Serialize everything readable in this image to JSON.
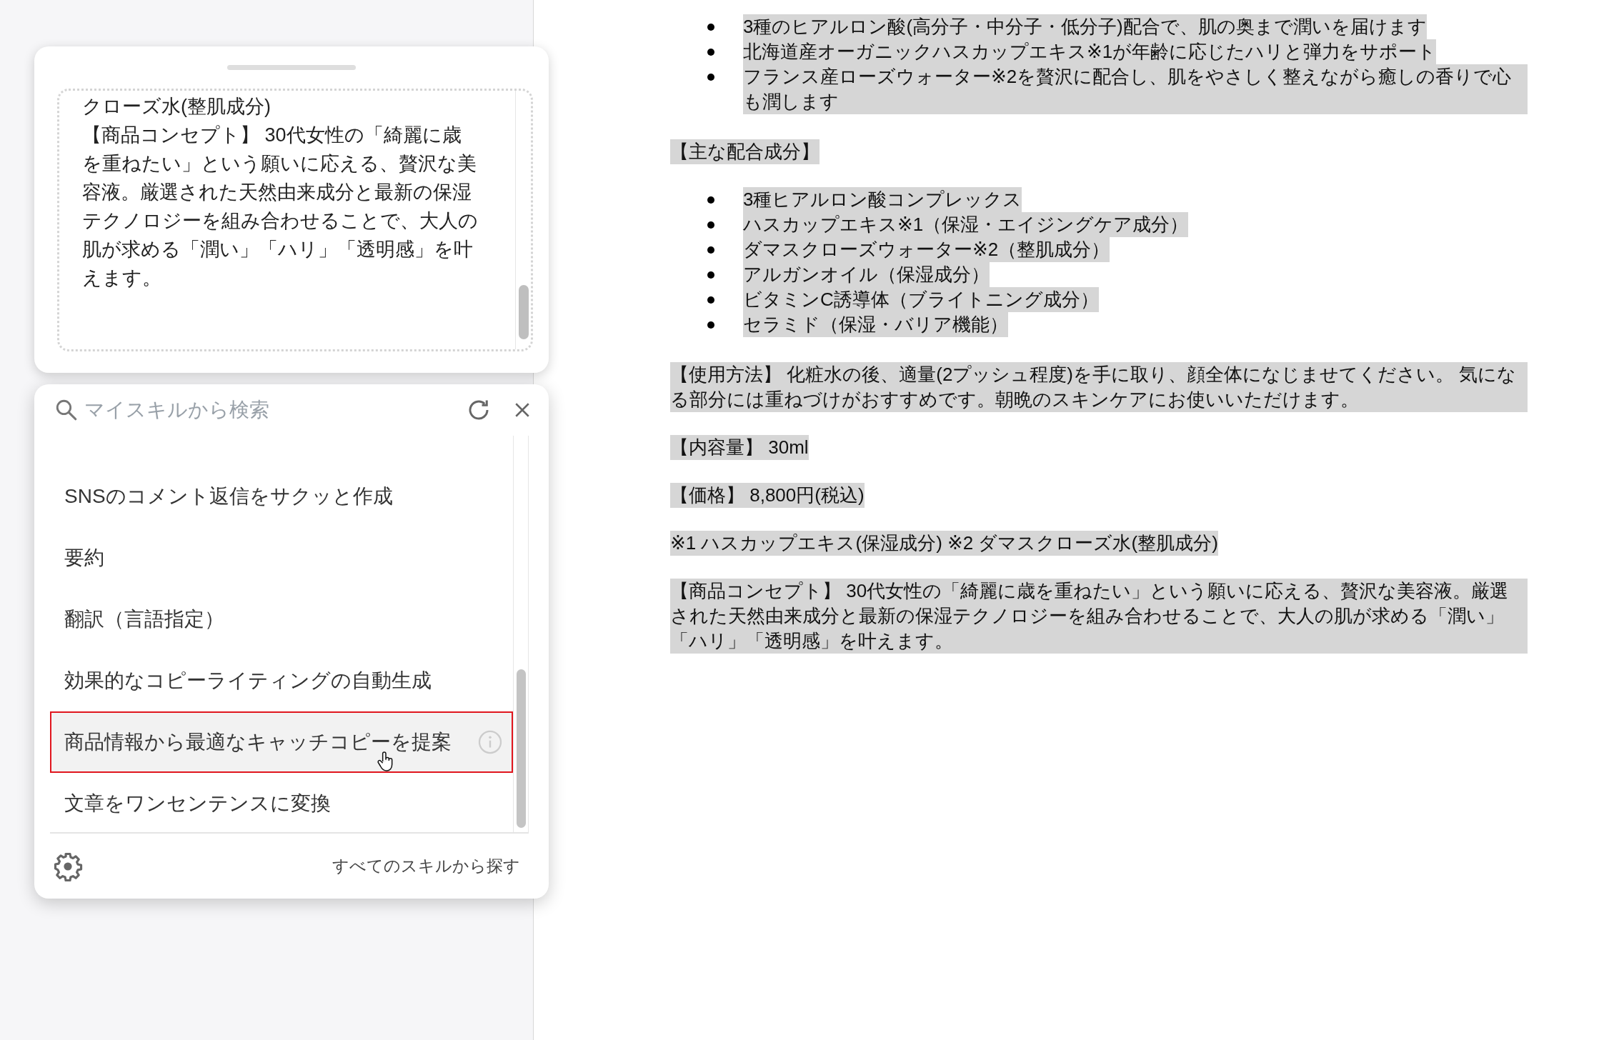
{
  "editor_card": {
    "paragraphs": [
      "クローズ水(整肌成分)",
      "【商品コンセプト】 30代女性の「綺麗に歳を重ねたい」という願いに応える、贅沢な美容液。厳選された天然由来成分と最新の保湿テクノロジーを組み合わせることで、大人の肌が求める「潤い」「ハリ」「透明感」を叶えます。"
    ]
  },
  "skill_menu": {
    "search": {
      "placeholder": "マイスキルから検索"
    },
    "items": [
      {
        "label": "SNSのコメント返信をサクッと作成",
        "selected": false
      },
      {
        "label": "要約",
        "selected": false
      },
      {
        "label": "翻訳（言語指定）",
        "selected": false
      },
      {
        "label": "効果的なコピーライティングの自動生成",
        "selected": false
      },
      {
        "label": "商品情報から最適なキャッチコピーを提案",
        "selected": true
      },
      {
        "label": "文章をワンセンテンスに変換",
        "selected": false
      }
    ],
    "footer_link": "すべてのスキルから探す"
  },
  "document": {
    "blocks": [
      {
        "kind": "bullets",
        "items": [
          "3種のヒアルロン酸(高分子・中分子・低分子)配合で、肌の奥まで潤いを届けます",
          "北海道産オーガニックハスカップエキス※1が年齢に応じたハリと弾力をサポート",
          "フランス産ローズウォーター※2を贅沢に配合し、肌をやさしく整えながら癒しの香りで心も潤します"
        ]
      },
      {
        "kind": "paragraph",
        "text": "【主な配合成分】"
      },
      {
        "kind": "bullets",
        "items": [
          "3種ヒアルロン酸コンプレックス",
          "ハスカップエキス※1（保湿・エイジングケア成分）",
          "ダマスクローズウォーター※2（整肌成分）",
          "アルガンオイル（保湿成分）",
          "ビタミンC誘導体（ブライトニング成分）",
          "セラミド（保湿・バリア機能）"
        ]
      },
      {
        "kind": "paragraph",
        "text": "【使用方法】 化粧水の後、適量(2プッシュ程度)を手に取り、顔全体になじませてください。 気になる部分には重ねづけがおすすめです。朝晩のスキンケアにお使いいただけます。"
      },
      {
        "kind": "paragraph",
        "text": "【内容量】 30ml"
      },
      {
        "kind": "paragraph",
        "text": "【価格】 8,800円(税込)"
      },
      {
        "kind": "paragraph",
        "text": "※1 ハスカップエキス(保湿成分) ※2 ダマスクローズ水(整肌成分)"
      },
      {
        "kind": "paragraph",
        "text": "【商品コンセプト】 30代女性の「綺麗に歳を重ねたい」という願いに応える、贅沢な美容液。厳選された天然由来成分と最新の保湿テクノロジーを組み合わせることで、大人の肌が求める「潤い」「ハリ」「透明感」を叶えます。"
      }
    ]
  }
}
